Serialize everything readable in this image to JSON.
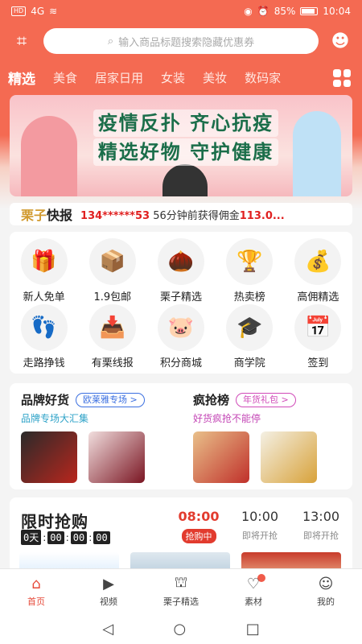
{
  "status_bar": {
    "network": "HD",
    "signal": "4G",
    "battery": "85%",
    "time": "10:04"
  },
  "search": {
    "placeholder": "输入商品标题搜索隐藏优惠券"
  },
  "tabs": [
    {
      "label": "精选"
    },
    {
      "label": "美食"
    },
    {
      "label": "居家日用"
    },
    {
      "label": "女装"
    },
    {
      "label": "美妆"
    },
    {
      "label": "数码家"
    }
  ],
  "banner": {
    "line1": "疫情反扑 齐心抗疫",
    "line2": "精选好物 守护健康"
  },
  "news": {
    "tag_a": "栗子",
    "tag_b": "快报",
    "user": "134******53",
    "text": "56分钟前获得佣金",
    "amount": "113.0..."
  },
  "menu": [
    {
      "label": "新人免单",
      "icon": "gift-icon",
      "glyph": "🎁"
    },
    {
      "label": "1.9包邮",
      "icon": "box-icon",
      "glyph": "📦"
    },
    {
      "label": "栗子精选",
      "icon": "chestnut-icon",
      "glyph": "🌰"
    },
    {
      "label": "热卖榜",
      "icon": "podium-icon",
      "glyph": "🏆"
    },
    {
      "label": "高佣精选",
      "icon": "money-bag-icon",
      "glyph": "💰"
    },
    {
      "label": "走路挣钱",
      "icon": "footprints-icon",
      "glyph": "👣"
    },
    {
      "label": "有栗线报",
      "icon": "inbox-icon",
      "glyph": "📥"
    },
    {
      "label": "积分商城",
      "icon": "piggy-bank-icon",
      "glyph": "🐷"
    },
    {
      "label": "商学院",
      "icon": "graduation-cap-icon",
      "glyph": "🎓"
    },
    {
      "label": "签到",
      "icon": "calendar-check-icon",
      "glyph": "📅"
    }
  ],
  "brand": {
    "title": "品牌好货",
    "pill": "欧莱雅专场 >",
    "sub": "品牌专场大汇集"
  },
  "hot": {
    "title": "疯抢榜",
    "pill": "年货礼包 >",
    "sub": "好货疯抢不能停"
  },
  "flash": {
    "title": "限时抢购",
    "countdown": {
      "days": "0天",
      "h": "00",
      "m": "00",
      "s": "00"
    },
    "slots": [
      {
        "time": "08:00",
        "status": "抢购中",
        "active": true
      },
      {
        "time": "10:00",
        "status": "即将开抢",
        "active": false
      },
      {
        "time": "13:00",
        "status": "即将开抢",
        "active": false
      }
    ]
  },
  "tabbar": [
    {
      "label": "首页",
      "icon": "home-icon",
      "glyph": "⌂"
    },
    {
      "label": "视频",
      "icon": "video-icon",
      "glyph": "▶"
    },
    {
      "label": "栗子精选",
      "icon": "chestnut-icon",
      "glyph": "⛫"
    },
    {
      "label": "素材",
      "icon": "material-icon",
      "glyph": "♡"
    },
    {
      "label": "我的",
      "icon": "user-icon",
      "glyph": "☺"
    }
  ],
  "nav": {
    "back": "◁",
    "home": "○",
    "recent": "□"
  },
  "colors": {
    "brand": "#f46a52",
    "accent_red": "#e23b2e"
  }
}
